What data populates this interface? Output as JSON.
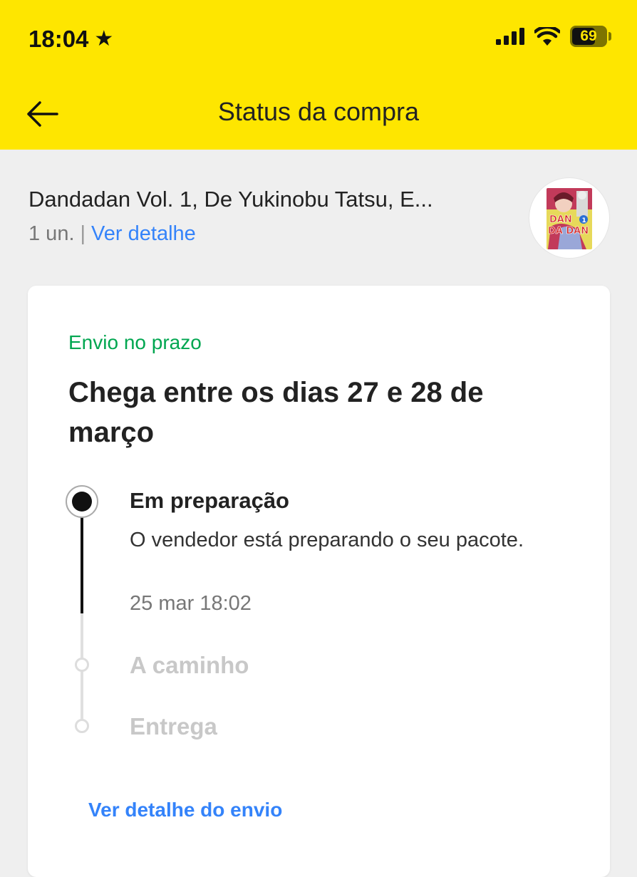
{
  "status_bar": {
    "time": "18:04",
    "time_icon": "star-icon",
    "battery_level": "69",
    "battery_fraction": 0.69
  },
  "header": {
    "title": "Status da compra",
    "back_icon": "arrow-left-icon",
    "background": "#fee600"
  },
  "product": {
    "title": "Dandadan Vol. 1, De Yukinobu Tatsu, E...",
    "quantity": "1 un.",
    "separator": "|",
    "detail_link": "Ver detalhe",
    "cover_text_1": "DAN",
    "cover_text_2": "DA DAN",
    "cover_volume": "1"
  },
  "shipment": {
    "status": "Envio no prazo",
    "status_color": "#00a650",
    "eta": "Chega entre os dias 27 e 28 de março",
    "steps": [
      {
        "title": "Em preparação",
        "description": "O vendedor está preparando o seu pacote.",
        "time": "25 mar 18:02",
        "state": "current"
      },
      {
        "title": "A caminho",
        "state": "pending"
      },
      {
        "title": "Entrega",
        "state": "pending"
      }
    ],
    "detail_link": "Ver detalhe do envio",
    "link_color": "#3483fa"
  }
}
